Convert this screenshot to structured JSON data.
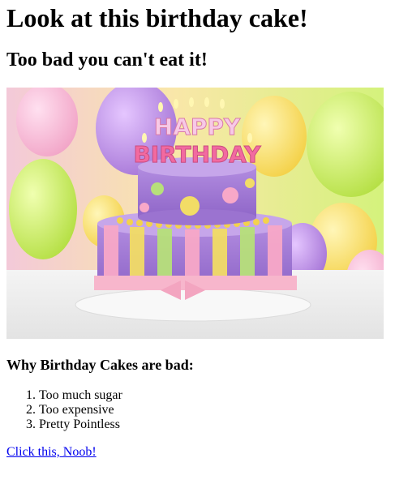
{
  "page": {
    "title": "Look at this birthday cake!",
    "subtitle": "Too bad you can't eat it!",
    "image": {
      "candle_letters_top": "HAPPY",
      "candle_letters_bottom": "BIRTHDAY"
    },
    "section_heading": "Why Birthday Cakes are bad:",
    "reasons": [
      "Too much sugar",
      "Too expensive",
      "Pretty Pointless"
    ],
    "link_text": "Click this, Noob!"
  }
}
